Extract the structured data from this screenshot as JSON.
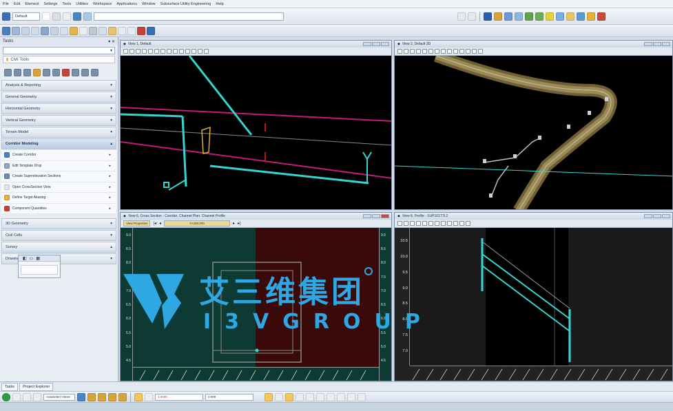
{
  "menubar": {
    "items": [
      "File",
      "Edit",
      "Element",
      "Settings",
      "Tools",
      "Utilities",
      "Workspace",
      "Applications",
      "Window",
      "Subsurface Utility Engineering",
      "Help"
    ]
  },
  "toolbar": {
    "level_combo": "Default"
  },
  "left_panel": {
    "title": "Tasks",
    "task_name": "Civil Tools",
    "categories_before": [
      "Analysis & Reporting",
      "General Geometry",
      "Horizontal Geometry",
      "Vertical Geometry",
      "Terrain Model"
    ],
    "active_category": "Corridor Modeling",
    "subitems": [
      "Create Corridor",
      "Edit Template Drop",
      "Create Superelevation Sections",
      "Open CrossSection View",
      "Define Target Aliasing",
      "Component Quantities"
    ],
    "categories_after": [
      "3D Geometry",
      "Civil Cells",
      "Survey",
      "Drawing"
    ]
  },
  "views": {
    "view1": {
      "title": "View 1, Default"
    },
    "view2": {
      "title": "View 2, Default 3D"
    },
    "view6": {
      "title": "View 6, Cross Section - Corridor: Channel Plan: Channel Profile",
      "prop_button": "View Properties",
      "station": "0+200.000",
      "y_ticks": [
        "9.0",
        "8.5",
        "8.0",
        "7.5",
        "7.0",
        "6.5",
        "6.0",
        "5.5",
        "5.0",
        "4.5"
      ]
    },
    "view8": {
      "title": "View 8, Profile - SUP101TTL2",
      "y_ticks": [
        "10.5",
        "10.0",
        "9.5",
        "9.0",
        "8.5",
        "8.0",
        "7.5",
        "7.0"
      ]
    }
  },
  "watermark": {
    "cn": "艾三维集团",
    "en": "I3VGROUP"
  },
  "statusbar": {
    "tabs": [
      "Tasks",
      "Project Explorer"
    ],
    "combo": "AutoSelect Views",
    "field1": "1.0000",
    "field2": "0.000"
  },
  "colors": {
    "alignment_cyan": "#35d6d0",
    "alignment_magenta": "#c21b78",
    "terrain_brown": "#8a7a4a",
    "watermark_blue": "#2fa7e3"
  }
}
